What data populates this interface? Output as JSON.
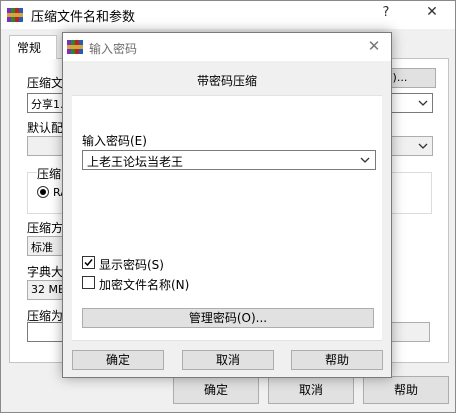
{
  "back_dialog": {
    "title": "压缩文件名和参数",
    "help_glyph": "?",
    "close_glyph": "✕",
    "tab_general": "常规",
    "archive_name_label": "压缩文",
    "archive_name_value": "分享1.",
    "browse_partial": "B)...",
    "default_profile_label": "默认配",
    "compress_format_label": "压缩",
    "format_radio_label": "RA",
    "compress_method_label": "压缩方",
    "compress_method_value": "标准",
    "dictionary_label": "字典大",
    "dictionary_value": "32 MB",
    "split_label": "压缩为",
    "ok_label": "确定",
    "cancel_label": "取消",
    "help_label": "帮助"
  },
  "password_dialog": {
    "title": "输入密码",
    "close_glyph": "✕",
    "heading": "带密码压缩",
    "password_label": "输入密码(E)",
    "password_value": "上老王论坛当老王",
    "show_password_label": "显示密码(S)",
    "show_password_checked": true,
    "encrypt_names_label": "加密文件名称(N)",
    "encrypt_names_checked": false,
    "manage_button": "管理密码(O)...",
    "ok_label": "确定",
    "cancel_label": "取消",
    "help_label": "帮助"
  },
  "icons": {
    "app": "winrar-books-icon",
    "dropdown": "chevron-down-icon",
    "check": "checkmark-icon"
  },
  "colors": {
    "dialog_bg": "#f0f0f0",
    "button_bg": "#e1e1e1",
    "button_border": "#adadad",
    "title_text_inactive": "#6d6d6d"
  }
}
